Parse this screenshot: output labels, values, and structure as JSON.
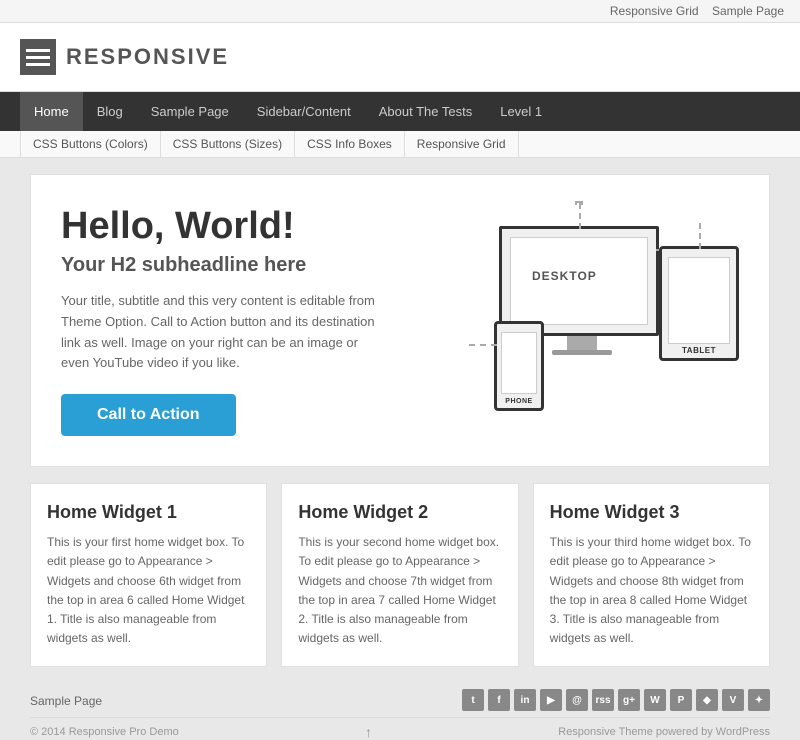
{
  "topbar": {
    "links": [
      "Responsive Grid",
      "Sample Page"
    ]
  },
  "header": {
    "logo_text": "RESPONSIVE",
    "logo_icon_label": "hamburger-menu-icon"
  },
  "main_nav": {
    "items": [
      {
        "label": "Home",
        "active": true
      },
      {
        "label": "Blog"
      },
      {
        "label": "Sample Page"
      },
      {
        "label": "Sidebar/Content"
      },
      {
        "label": "About The Tests"
      },
      {
        "label": "Level 1"
      }
    ]
  },
  "sub_nav": {
    "items": [
      {
        "label": "CSS Buttons (Colors)"
      },
      {
        "label": "CSS Buttons (Sizes)"
      },
      {
        "label": "CSS Info Boxes"
      },
      {
        "label": "Responsive Grid"
      }
    ]
  },
  "hero": {
    "h1": "Hello, World!",
    "h2": "Your H2 subheadline here",
    "body_text": "Your title, subtitle and this very content is editable from Theme Option. Call to Action button and its destination link as well. Image on your right can be an image or even YouTube video if you like.",
    "cta_label": "Call to Action",
    "device_labels": {
      "desktop": "DESKTOP",
      "tablet": "TABLET",
      "phone": "PHONE"
    }
  },
  "widgets": [
    {
      "title": "Home Widget 1",
      "text": "This is your first home widget box. To edit please go to Appearance > Widgets and choose 6th widget from the top in area 6 called Home Widget 1. Title is also manageable from widgets as well."
    },
    {
      "title": "Home Widget 2",
      "text": "This is your second home widget box. To edit please go to Appearance > Widgets and choose 7th widget from the top in area 7 called Home Widget 2. Title is also manageable from widgets as well."
    },
    {
      "title": "Home Widget 3",
      "text": "This is your third home widget box. To edit please go to Appearance > Widgets and choose 8th widget from the top in area 8 called Home Widget 3. Title is also manageable from widgets as well."
    }
  ],
  "footer": {
    "bottom_link": "Sample Page",
    "copyright": "© 2014 Responsive Pro Demo",
    "powered": "Responsive Theme powered by WordPress",
    "social_icons": [
      "t",
      "f",
      "in",
      "y",
      "@",
      "rss",
      "g+",
      "wp",
      "P",
      "♦",
      "v",
      "▶"
    ]
  }
}
